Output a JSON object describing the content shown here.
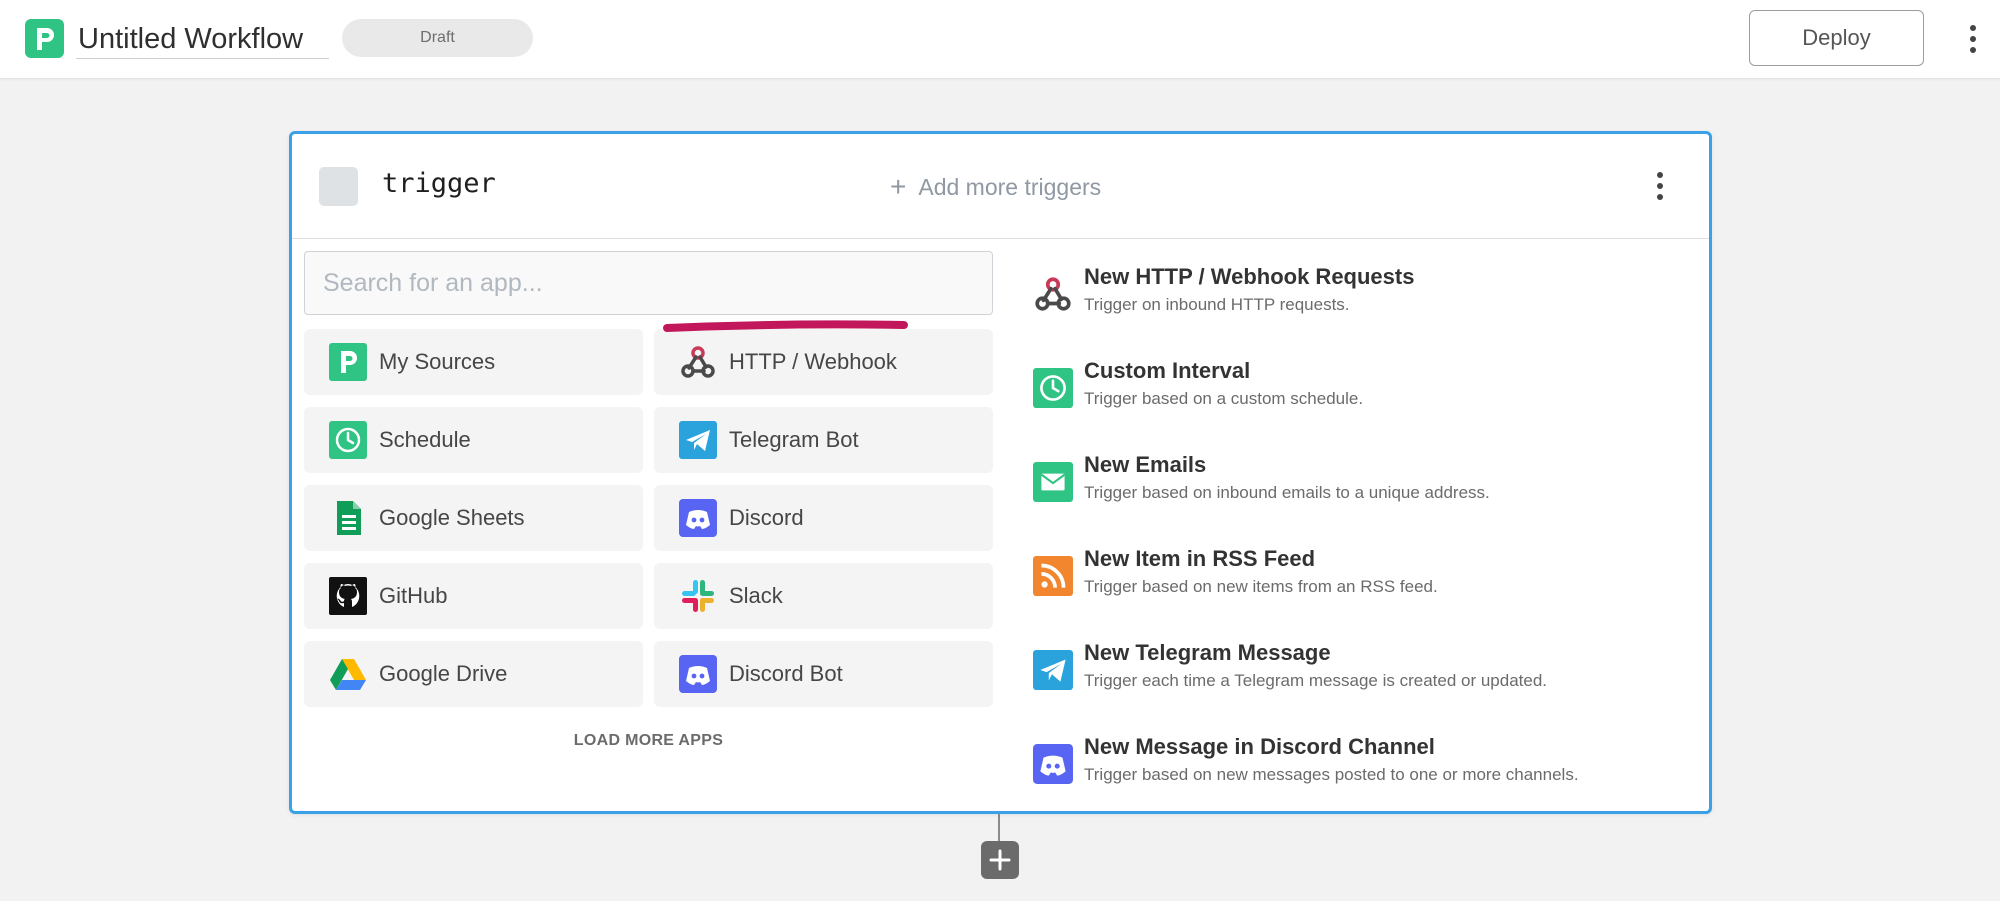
{
  "header": {
    "logo_icon": "pipedream-logo-icon",
    "workflow_title": "Untitled Workflow",
    "status_badge": "Draft",
    "deploy_label": "Deploy",
    "menu_icon": "vertical-dots-icon"
  },
  "trigger_card": {
    "title": "trigger",
    "add_more_triggers": "Add more triggers",
    "search": {
      "value": "",
      "placeholder": "Search for an app..."
    },
    "apps": [
      {
        "label": "My Sources",
        "icon": "pipedream-sources-icon"
      },
      {
        "label": "HTTP / Webhook",
        "icon": "webhook-icon"
      },
      {
        "label": "Schedule",
        "icon": "clock-icon"
      },
      {
        "label": "Telegram Bot",
        "icon": "telegram-icon"
      },
      {
        "label": "Google Sheets",
        "icon": "google-sheets-icon"
      },
      {
        "label": "Discord",
        "icon": "discord-icon"
      },
      {
        "label": "GitHub",
        "icon": "github-icon"
      },
      {
        "label": "Slack",
        "icon": "slack-icon"
      },
      {
        "label": "Google Drive",
        "icon": "google-drive-icon"
      },
      {
        "label": "Discord Bot",
        "icon": "discord-icon"
      }
    ],
    "load_more": "LOAD MORE APPS",
    "suggested_triggers": [
      {
        "title": "New HTTP / Webhook Requests",
        "description": "Trigger on inbound HTTP requests.",
        "icon": "webhook-icon"
      },
      {
        "title": "Custom Interval",
        "description": "Trigger based on a custom schedule.",
        "icon": "clock-icon"
      },
      {
        "title": "New Emails",
        "description": "Trigger based on inbound emails to a unique address.",
        "icon": "email-icon"
      },
      {
        "title": "New Item in RSS Feed",
        "description": "Trigger based on new items from an RSS feed.",
        "icon": "rss-icon"
      },
      {
        "title": "New Telegram Message",
        "description": "Trigger each time a Telegram message is created or updated.",
        "icon": "telegram-icon"
      },
      {
        "title": "New Message in Discord Channel",
        "description": "Trigger based on new messages posted to one or more channels.",
        "icon": "discord-icon"
      }
    ]
  },
  "colors": {
    "brand_green": "#2fc384",
    "card_border": "#3aa1e6",
    "highlight_underline": "#c2185b"
  },
  "add_step_icon": "plus-icon"
}
